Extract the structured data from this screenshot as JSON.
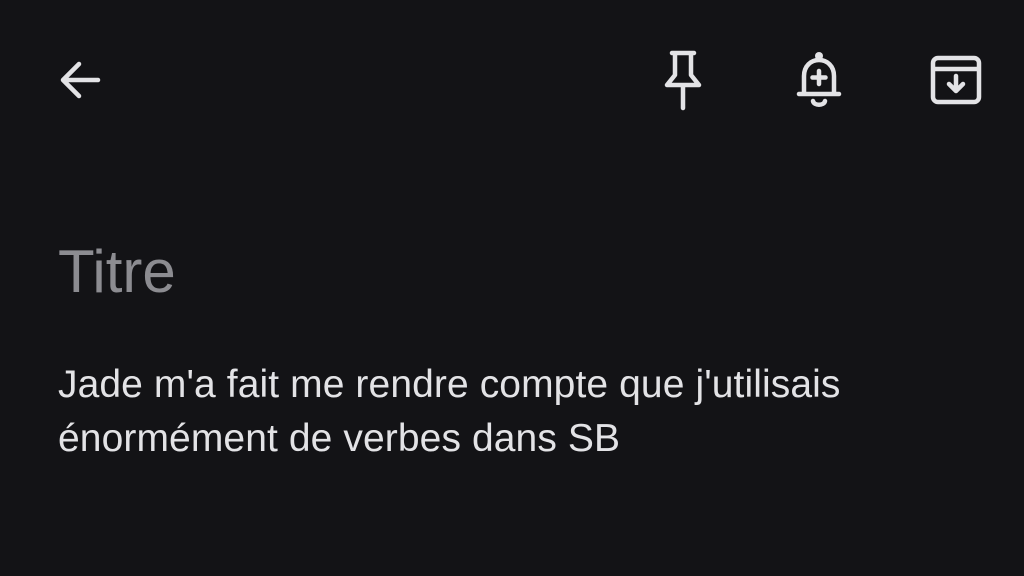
{
  "toolbar": {
    "back_icon": "arrow-left-icon",
    "pin_icon": "pin-icon",
    "reminder_icon": "bell-plus-icon",
    "archive_icon": "archive-icon",
    "icon_color": "#e3e3e6"
  },
  "note": {
    "title_placeholder": "Titre",
    "body": "Jade m'a fait me rendre compte que j'utilisais énormément de verbes dans SB"
  },
  "colors": {
    "background": "#131316",
    "placeholder": "#8c8c91",
    "text": "#e3e3e6"
  }
}
